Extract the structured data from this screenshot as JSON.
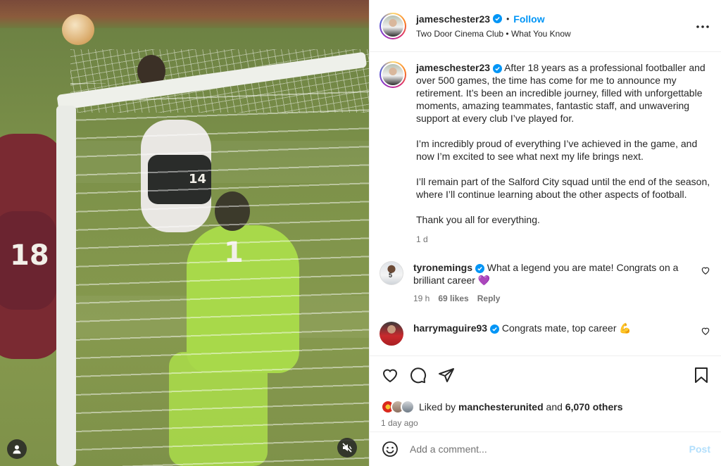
{
  "post": {
    "author": "jameschester23",
    "follow_label": "Follow",
    "separator": "•",
    "audio": {
      "artist": "Two Door Cinema Club",
      "separator": "•",
      "track": "What You Know"
    },
    "caption": {
      "username": "jameschester23",
      "paragraphs": [
        "After 18 years as a professional footballer and over 500 games, the time has come for me to announce my retirement. It’s been an incredible journey, filled with unforgettable moments, amazing teammates, fantastic staff, and unwavering support at every club I’ve played for.",
        "I’m incredibly proud of everything I’ve achieved in the game, and now I’m excited to see what next my life brings next.",
        "I’ll remain part of the Salford City squad until the end of the season, where I’ll continue learning about the other aspects of football.",
        "Thank you all for everything."
      ],
      "age": "1 d"
    }
  },
  "comments": [
    {
      "username": "tyronemings",
      "text": "What a legend you are mate! Congrats on a brilliant career 💜",
      "age": "19 h",
      "likes": "69 likes",
      "reply_label": "Reply"
    },
    {
      "username": "harrymaguire93",
      "text": "Congrats mate, top career 💪",
      "age": "",
      "likes": "",
      "reply_label": ""
    }
  ],
  "likes": {
    "prefix": "Liked by",
    "user": "manchesterunited",
    "conjunction": "and",
    "others": "6,070 others"
  },
  "posted_ago": "1 day ago",
  "comment_box": {
    "placeholder": "Add a comment...",
    "post_label": "Post"
  },
  "media": {
    "jersey_numbers": [
      "14",
      "1",
      "18",
      "5"
    ]
  },
  "colors": {
    "accent": "#0095f6",
    "post_disabled": "#b2dffc",
    "muted": "#737373"
  }
}
